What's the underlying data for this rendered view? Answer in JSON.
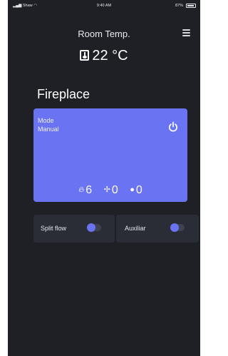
{
  "status_bar": {
    "carrier": "Shaw",
    "time": "9:40 AM",
    "battery_text": "87%"
  },
  "header": {
    "title": "Room Temp.",
    "temperature": "22 °C"
  },
  "device": {
    "name": "Fireplace"
  },
  "mode_card": {
    "label": "Mode",
    "value": "Manual",
    "flame_level": "6",
    "fan_level": "0",
    "light_level": "0"
  },
  "toggles": {
    "split_flow_label": "Split flow",
    "auxiliar_label": "Auxiliar"
  },
  "colors": {
    "background": "#1f2026",
    "accent": "#6a73f2",
    "card": "#2b2d36"
  },
  "icons": {
    "menu": "hamburger-menu-icon",
    "thermometer": "thermometer-icon",
    "power": "power-icon",
    "flame": "flame-icon",
    "fan": "fan-icon",
    "light": "lightbulb-icon"
  }
}
